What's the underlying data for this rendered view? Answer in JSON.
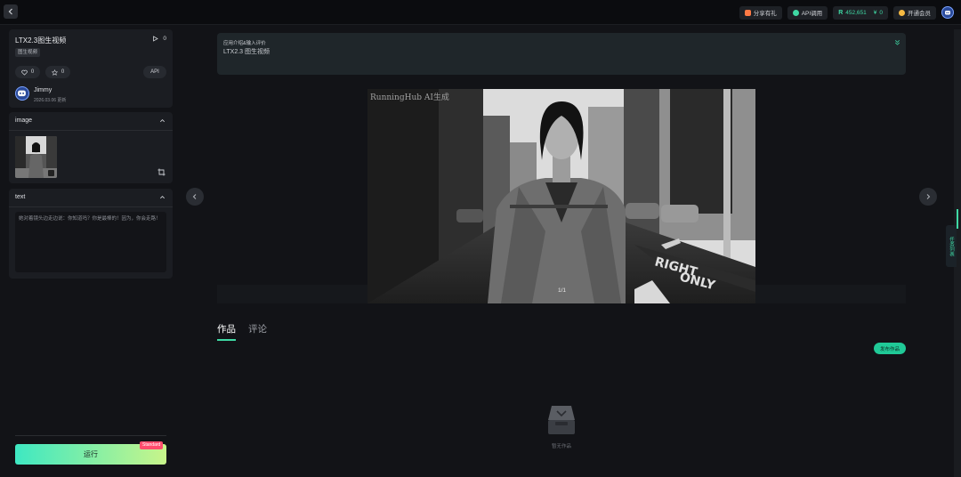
{
  "topbar": {
    "share_label": "分享有礼",
    "api_label": "API调用",
    "coins": "452,651",
    "yuan_symbol": "¥",
    "yuan_value": "0",
    "vip_label": "开通会员"
  },
  "app": {
    "title": "LTX2.3图生视频",
    "run_count": "0",
    "tag": "图生视频",
    "like_count": "0",
    "star_count": "0",
    "api_label": "API",
    "author": "Jimmy",
    "date": "2026.03.06 更新"
  },
  "image_section": {
    "title": "image"
  },
  "text_section": {
    "title": "text",
    "value": "她对着镜头边走边说：你知道吗？你是最棒的！因为，你会走路！"
  },
  "run": {
    "label": "运行",
    "badge": "Standard"
  },
  "intro": {
    "heading": "应用介绍&输入评价",
    "body": "LTX2.3 图生视频"
  },
  "viewer": {
    "watermark": "RunningHub AI生成",
    "counter": "1/1",
    "sign_text_1": "RIGHT",
    "sign_text_2": "ONLY"
  },
  "tabs": [
    {
      "label": "作品"
    },
    {
      "label": "评论"
    }
  ],
  "publish_label": "发布作品",
  "empty_label": "暂无作品",
  "side_tab_label": "任务列表",
  "colors": {
    "accent": "#3fd9a4",
    "badge": "#ff4d6d"
  }
}
